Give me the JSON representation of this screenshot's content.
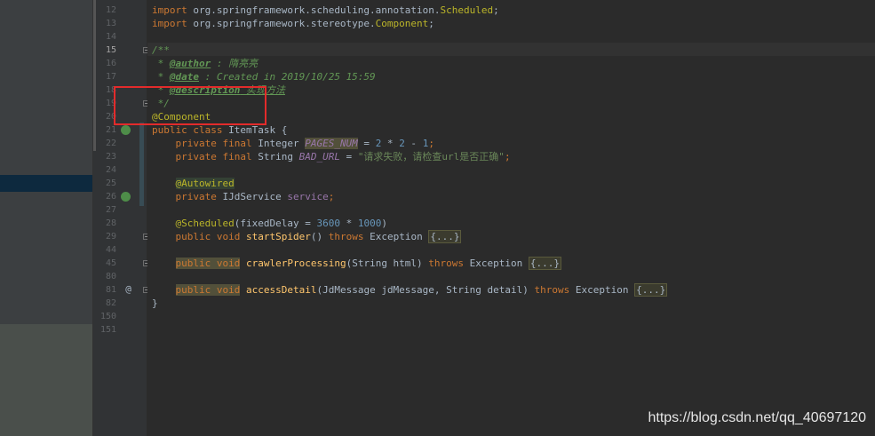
{
  "line_numbers": [
    "12",
    "13",
    "14",
    "15",
    "16",
    "17",
    "18",
    "19",
    "20",
    "21",
    "22",
    "23",
    "24",
    "25",
    "26",
    "27",
    "28",
    "29",
    "44",
    "45",
    "80",
    "81",
    "82",
    "150",
    "151"
  ],
  "code": {
    "l12": {
      "kw": "import",
      "pkg": " org.springframework.scheduling.annotation.",
      "cls": "Scheduled",
      "end": ";"
    },
    "l13": {
      "kw": "import",
      "pkg": " org.springframework.stereotype.",
      "cls": "Component",
      "end": ";"
    },
    "l15": {
      "text": "/**"
    },
    "l16": {
      "star": " * ",
      "tag": "@author",
      "val": " : 隋亮亮"
    },
    "l17": {
      "star": " * ",
      "tag": "@date",
      "val": " : Created in 2019/10/25 15:59"
    },
    "l18": {
      "star": " * ",
      "tag": "@description",
      "val": " 实现方法"
    },
    "l19": {
      "text": " */"
    },
    "l20": {
      "anno": "@Component"
    },
    "l21": {
      "kw": "public class",
      "rest": " ItemTask {"
    },
    "l22": {
      "indent": "    ",
      "kw": "private final",
      "type": " Integer ",
      "name": "PAGES_NUM",
      "eq": " = ",
      "n1": "2",
      "op1": " * ",
      "n2": "2",
      "op2": " - ",
      "n3": "1",
      "end": ";"
    },
    "l23": {
      "indent": "    ",
      "kw": "private final",
      "type": " String ",
      "name": "BAD_URL",
      "eq": " = ",
      "str": "\"请求失败，请检查url是否正确\"",
      "end": ";"
    },
    "l25": {
      "indent": "    ",
      "anno": "@Autowired"
    },
    "l26": {
      "indent": "    ",
      "kw": "private",
      "type": " IJdService ",
      "name": "service",
      "end": ";"
    },
    "l28": {
      "indent": "    ",
      "anno": "@Scheduled",
      "open": "(fixedDelay = ",
      "n1": "3600",
      "op": " * ",
      "n2": "1000",
      "close": ")"
    },
    "l29": {
      "indent": "    ",
      "kw": "public void",
      "sp": " ",
      "method": "startSpider",
      "args": "() ",
      "kw2": "throws",
      "exc": " Exception ",
      "fold": "{...}"
    },
    "l45": {
      "indent": "    ",
      "kw": "public void",
      "sp": " ",
      "method": "crawlerProcessing",
      "args": "(String html) ",
      "kw2": "throws",
      "exc": " Exception ",
      "fold": "{...}"
    },
    "l82": {
      "indent": "    ",
      "kw": "public void",
      "sp": " ",
      "method": "accessDetail",
      "args": "(JdMessage jdMessage, String detail) ",
      "kw2": "throws",
      "exc": " Exception ",
      "fold": "{...}"
    },
    "l150": {
      "text": "}"
    }
  },
  "gutter_icons": {
    "at_symbol": "@"
  },
  "watermark": "https://blog.csdn.net/qq_40697120",
  "colors": {
    "highlight_box": "#e32b2b",
    "background": "#2b2b2b"
  }
}
